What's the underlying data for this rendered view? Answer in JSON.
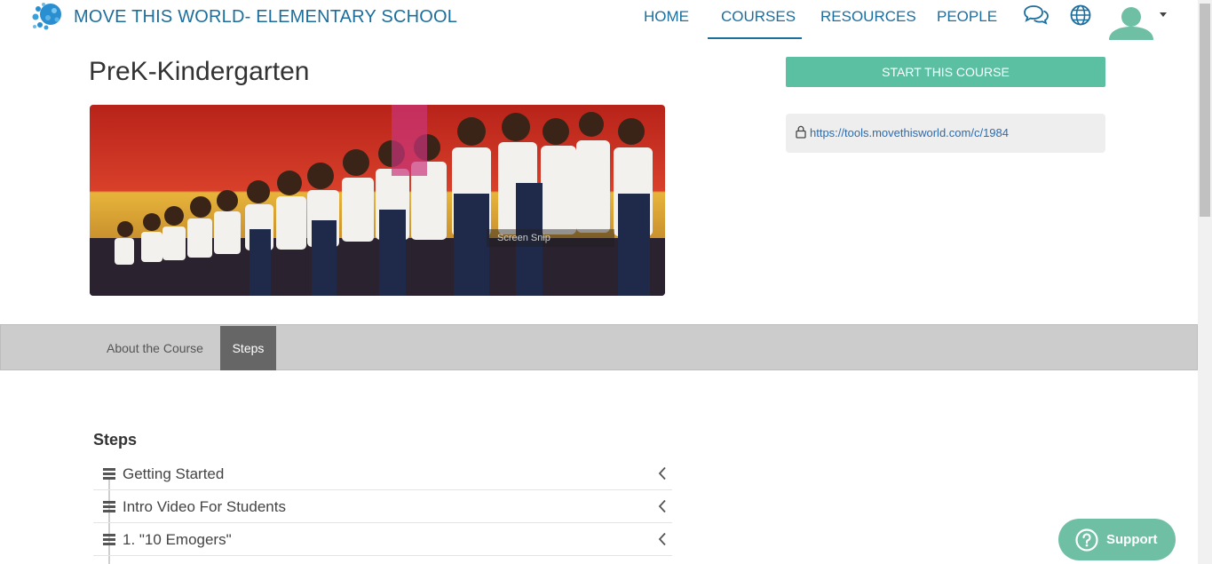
{
  "header": {
    "brand": "MOVE THIS WORLD- ELEMENTARY SCHOOL",
    "nav": [
      {
        "label": "HOME"
      },
      {
        "label": "COURSES",
        "active": true
      },
      {
        "label": "RESOURCES"
      },
      {
        "label": "PEOPLE"
      }
    ],
    "icons": [
      "chat-icon",
      "globe-icon",
      "user-avatar-icon",
      "caret-down-icon"
    ],
    "accent_color": "#1c6e9d"
  },
  "course": {
    "title": "PreK-Kindergarten",
    "image_overlay_text": "Screen Snip",
    "start_button": "START THIS COURSE",
    "start_button_color": "#5bbfa2",
    "url": "https://tools.movethisworld.com/c/1984"
  },
  "tabs": [
    {
      "label": "About the Course",
      "active": false
    },
    {
      "label": "Steps",
      "active": true
    }
  ],
  "steps": {
    "heading": "Steps",
    "items": [
      {
        "label": "Getting Started"
      },
      {
        "label": "Intro Video For Students"
      },
      {
        "label": "1. \"10 Emogers\""
      }
    ]
  },
  "support": {
    "label": "Support",
    "color": "#6fbfa4"
  }
}
